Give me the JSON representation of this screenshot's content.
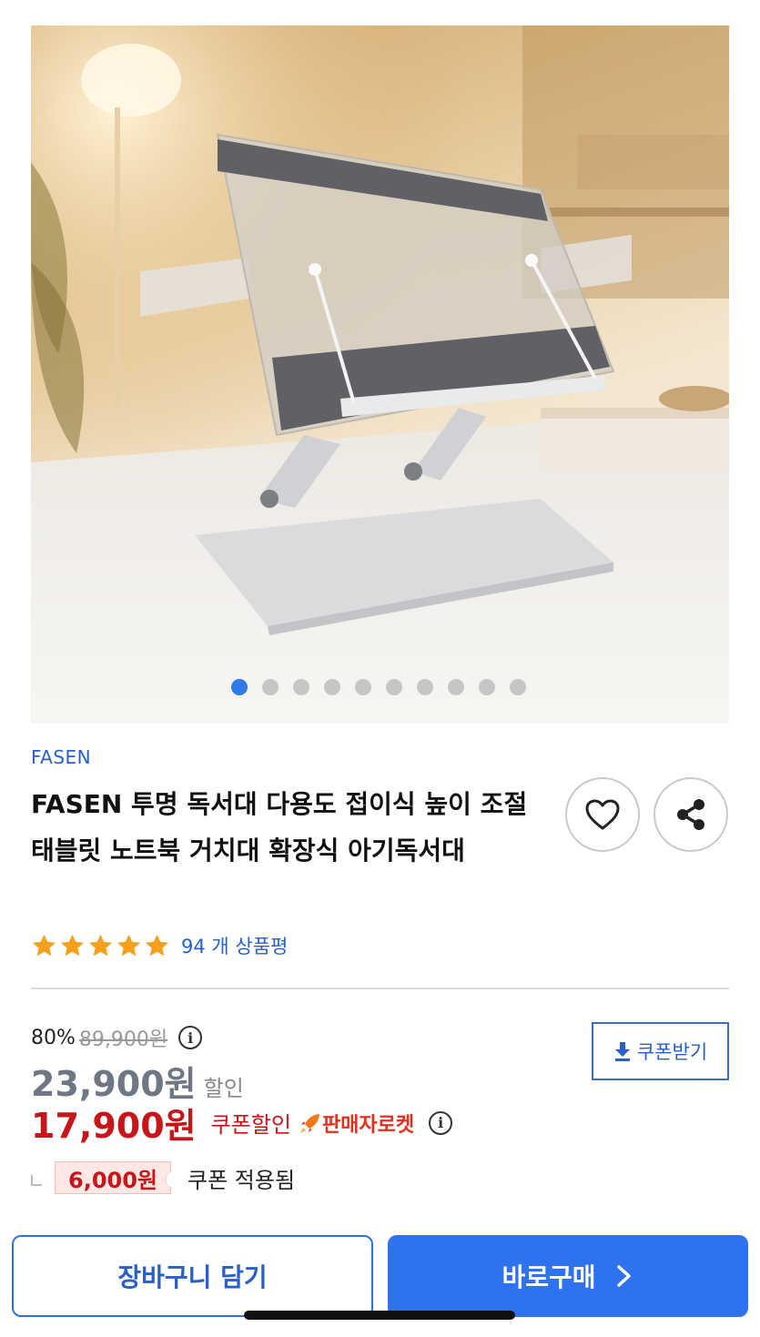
{
  "gallery": {
    "total_images": 10,
    "active_index": 0
  },
  "product": {
    "brand": "FASEN",
    "title": "FASEN 투명 독서대 다용도 접이식 높이 조절 태블릿 노트북 거치대 확장식 아기독서대",
    "rating_stars": 5,
    "review_text": "94 개 상품평"
  },
  "pricing": {
    "discount_rate": "80%",
    "original_price": "89,900원",
    "sale_price": "23,900원",
    "sale_label": "할인",
    "coupon_price": "17,900원",
    "coupon_label": "쿠폰할인",
    "seller_badge": "판매자로켓",
    "coupon_amount": "6,000원",
    "coupon_applied_label": "쿠폰 적용됨",
    "get_coupon_label": "쿠폰받기"
  },
  "actions": {
    "cart_label": "장바구니 담기",
    "buy_label": "바로구매"
  },
  "colors": {
    "accent_blue": "#2f72ef",
    "price_red": "#c7151a",
    "star_orange": "#f5a01a"
  },
  "icons": [
    "heart-icon",
    "share-icon",
    "star-icon",
    "info-icon",
    "download-icon",
    "rocket-icon",
    "chevron-right-icon"
  ]
}
